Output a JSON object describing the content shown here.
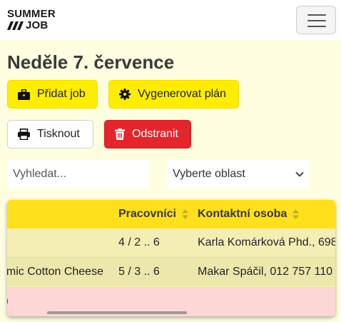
{
  "navbar": {
    "logo_top": "SUMMER",
    "logo_bottom": "JOB"
  },
  "page": {
    "title": "Neděle 7. července"
  },
  "toolbar": {
    "add_job_label": "Přidat job",
    "generate_plan_label": "Vygenerovat plán",
    "print_label": "Tisknout",
    "delete_label": "Odstranit"
  },
  "filters": {
    "search_placeholder": "Vyhledat...",
    "area_select_value": "Vyberte oblast"
  },
  "table": {
    "headers": [
      "Pracovníci",
      "Kontaktní osoba"
    ],
    "rows": [
      {
        "name": "",
        "workers": "4 / 2 .. 6",
        "contact": "Karla Komárková Phd., 698"
      },
      {
        "name": "omic Cotton Cheese",
        "workers": "5 / 3 .. 6",
        "contact": "Makar Spáčil, 012 757 110"
      },
      {
        "name": ":)",
        "workers": "",
        "contact": ""
      }
    ]
  },
  "colors": {
    "background": "#fffee0",
    "accent_yellow": "#ffed00",
    "danger_red": "#e4252c",
    "table_header": "#ffe01a",
    "row_alert": "#fdd6d6"
  },
  "icons": {
    "add_job": "briefcase-icon",
    "generate_plan": "gear-icon",
    "print": "printer-icon",
    "delete": "trash-icon",
    "menu": "hamburger-icon",
    "select": "chevron-down-icon",
    "sort": "sort-icon"
  }
}
